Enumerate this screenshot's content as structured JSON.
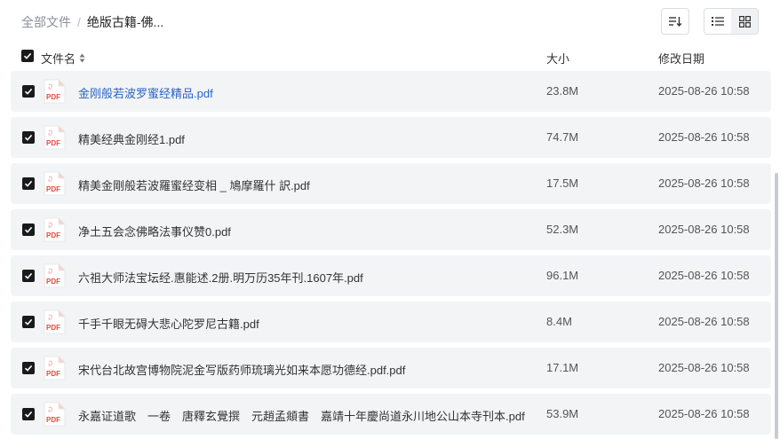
{
  "breadcrumb": {
    "root": "全部文件",
    "separator": "/",
    "current": "绝版古籍-佛..."
  },
  "header": {
    "name": "文件名",
    "size": "大小",
    "date": "修改日期"
  },
  "files": [
    {
      "name": "金刚般若波罗蜜经精品.pdf",
      "size": "23.8M",
      "date": "2025-08-26 10:58"
    },
    {
      "name": "精美经典金刚经1.pdf",
      "size": "74.7M",
      "date": "2025-08-26 10:58"
    },
    {
      "name": "精美金剛般若波羅蜜经变相 _ 鳩摩羅什 訳.pdf",
      "size": "17.5M",
      "date": "2025-08-26 10:58"
    },
    {
      "name": "净土五会念佛略法事仪赞0.pdf",
      "size": "52.3M",
      "date": "2025-08-26 10:58"
    },
    {
      "name": "六祖大师法宝坛经.惠能述.2册.明万历35年刊.1607年.pdf",
      "size": "96.1M",
      "date": "2025-08-26 10:58"
    },
    {
      "name": "千手千眼无碍大悲心陀罗尼古籍.pdf",
      "size": "8.4M",
      "date": "2025-08-26 10:58"
    },
    {
      "name": "宋代台北故宫博物院泥金写版药师琉璃光如来本愿功德经.pdf.pdf",
      "size": "17.1M",
      "date": "2025-08-26 10:58"
    },
    {
      "name": "永嘉证道歌　一卷　唐釋玄覺撰　元趙孟頫書　嘉靖十年慶尚道永川地公山本寺刊本.pdf",
      "size": "53.9M",
      "date": "2025-08-26 10:58"
    }
  ],
  "icons": {
    "file": "pdf-file-icon",
    "sort": "sort-icon",
    "list": "list-view-icon",
    "grid": "grid-view-icon"
  },
  "pdf_icon_label": "PDF",
  "colors": {
    "accent_link": "#2a63c8",
    "pdf_red": "#e8483c",
    "row_bg": "#f3f4f6"
  }
}
